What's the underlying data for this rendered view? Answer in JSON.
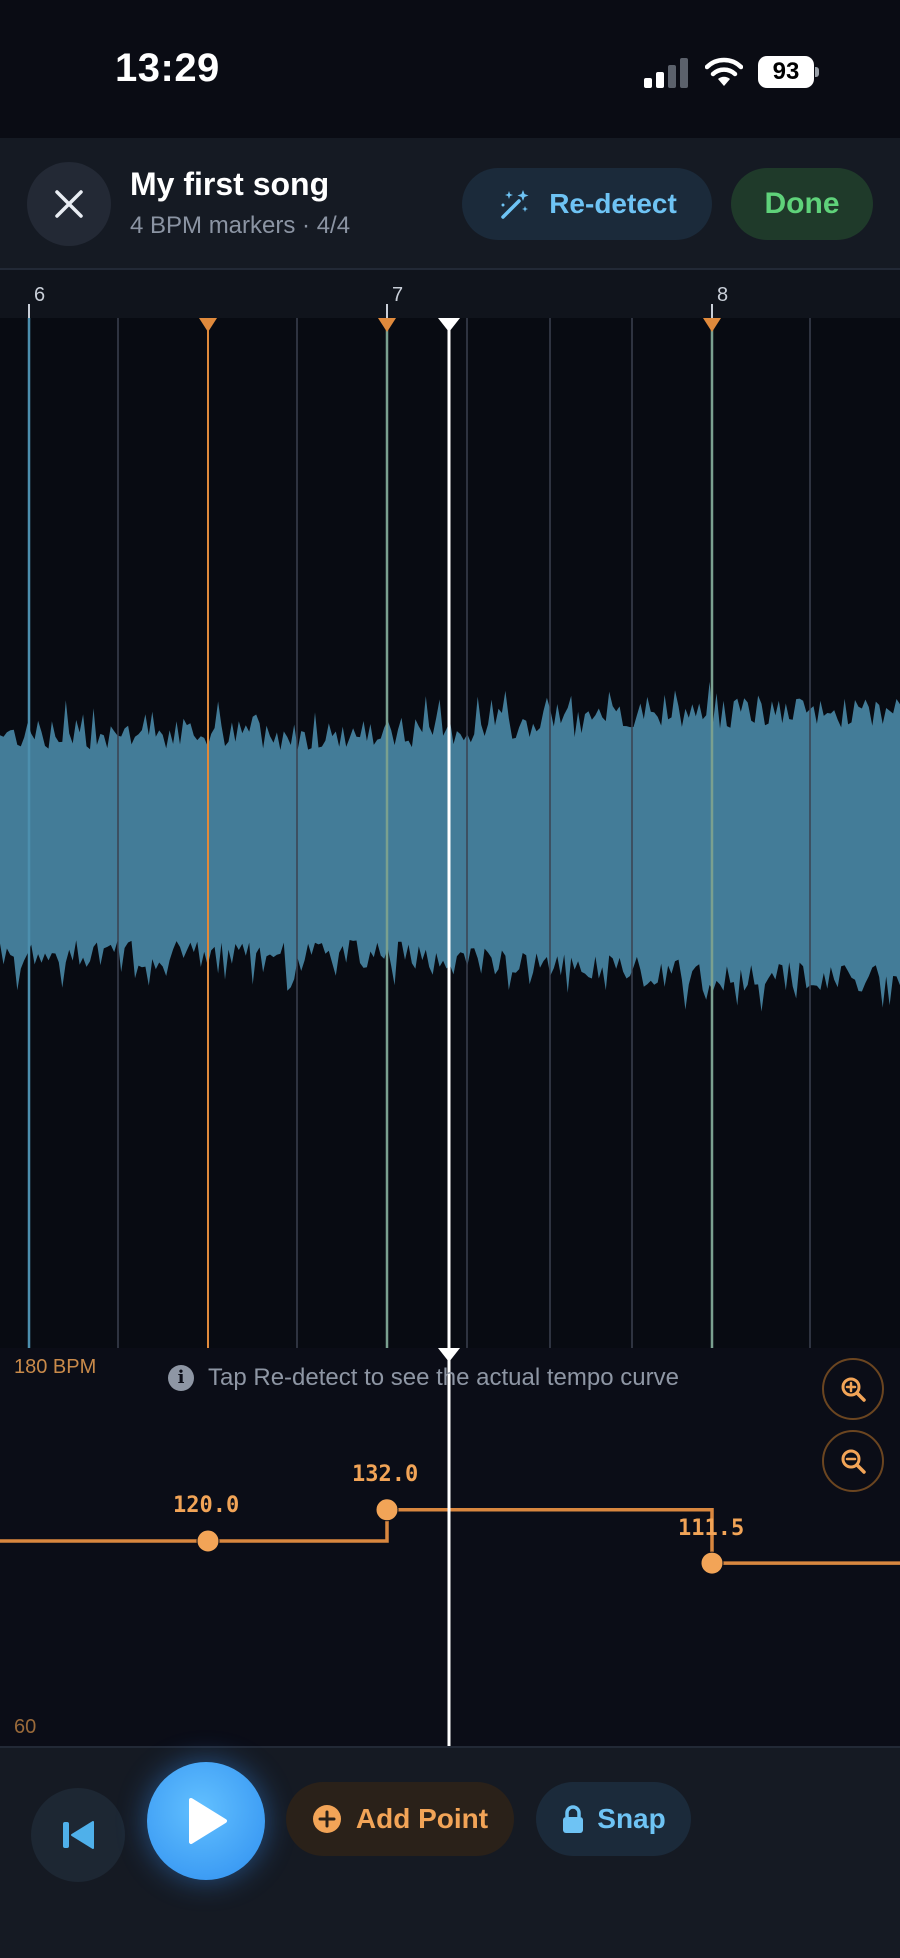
{
  "status": {
    "time": "13:29",
    "battery": "93"
  },
  "header": {
    "title": "My first song",
    "subtitle": "4 BPM markers · 4/4",
    "redetect_label": "Re-detect",
    "done_label": "Done"
  },
  "ruler": {
    "bars": [
      "6",
      "7",
      "8"
    ]
  },
  "tempo": {
    "max_label": "180 BPM",
    "min_label": "60",
    "hint": "Tap Re-detect to see the actual tempo curve",
    "points": [
      {
        "label": "120.0",
        "bpm": 120.0
      },
      {
        "label": "132.0",
        "bpm": 132.0
      },
      {
        "label": "111.5",
        "bpm": 111.5
      }
    ]
  },
  "toolbar": {
    "add_point_label": "Add Point",
    "snap_label": "Snap"
  },
  "colors": {
    "waveform": "#437c98",
    "marker": "#e08a3c",
    "tempo_line": "#d9873f",
    "beat_line": "#3a4150",
    "downbeat_line": "#4c8fae",
    "playhead": "#ffffff"
  }
}
